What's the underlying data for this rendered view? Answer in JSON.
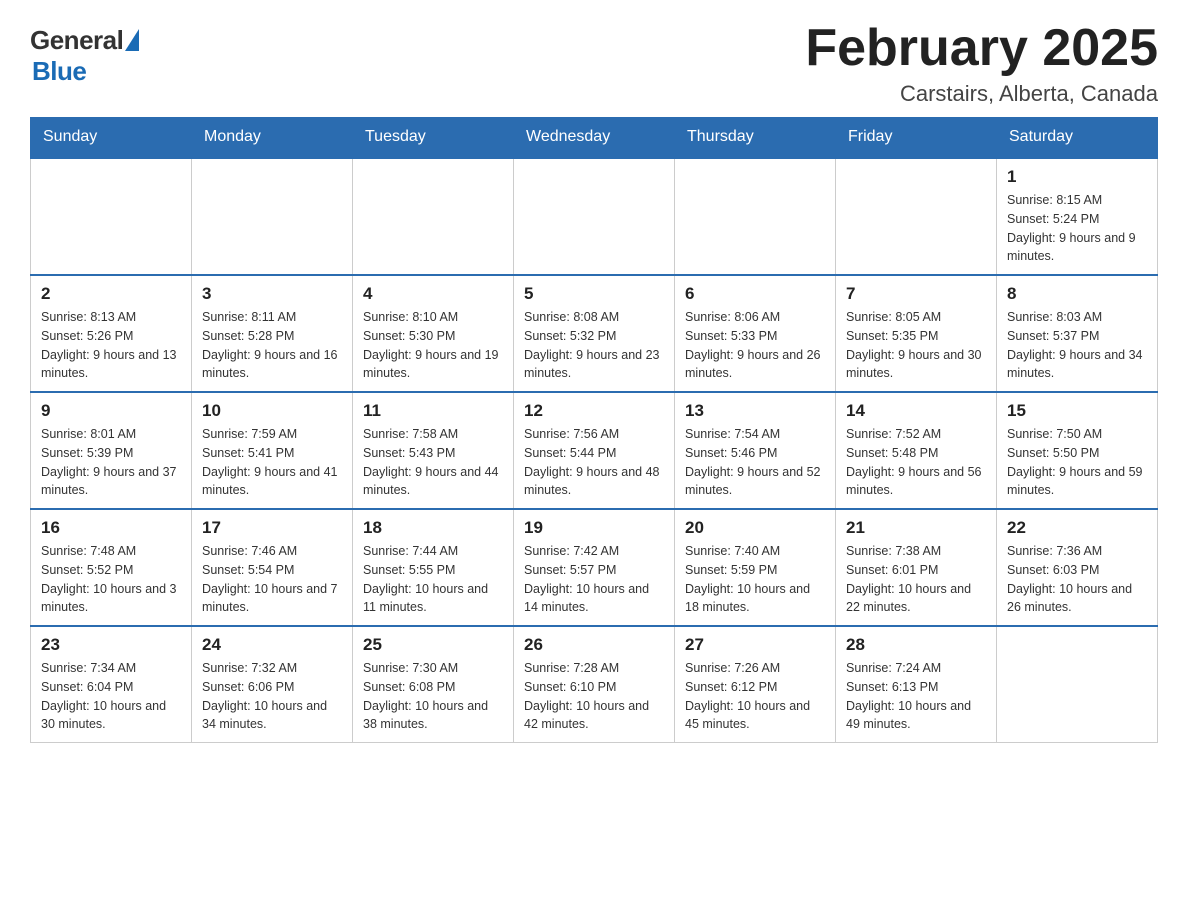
{
  "header": {
    "logo": {
      "general": "General",
      "blue": "Blue"
    },
    "title": "February 2025",
    "location": "Carstairs, Alberta, Canada"
  },
  "days_of_week": [
    "Sunday",
    "Monday",
    "Tuesday",
    "Wednesday",
    "Thursday",
    "Friday",
    "Saturday"
  ],
  "weeks": [
    [
      {
        "day": "",
        "info": ""
      },
      {
        "day": "",
        "info": ""
      },
      {
        "day": "",
        "info": ""
      },
      {
        "day": "",
        "info": ""
      },
      {
        "day": "",
        "info": ""
      },
      {
        "day": "",
        "info": ""
      },
      {
        "day": "1",
        "info": "Sunrise: 8:15 AM\nSunset: 5:24 PM\nDaylight: 9 hours and 9 minutes."
      }
    ],
    [
      {
        "day": "2",
        "info": "Sunrise: 8:13 AM\nSunset: 5:26 PM\nDaylight: 9 hours and 13 minutes."
      },
      {
        "day": "3",
        "info": "Sunrise: 8:11 AM\nSunset: 5:28 PM\nDaylight: 9 hours and 16 minutes."
      },
      {
        "day": "4",
        "info": "Sunrise: 8:10 AM\nSunset: 5:30 PM\nDaylight: 9 hours and 19 minutes."
      },
      {
        "day": "5",
        "info": "Sunrise: 8:08 AM\nSunset: 5:32 PM\nDaylight: 9 hours and 23 minutes."
      },
      {
        "day": "6",
        "info": "Sunrise: 8:06 AM\nSunset: 5:33 PM\nDaylight: 9 hours and 26 minutes."
      },
      {
        "day": "7",
        "info": "Sunrise: 8:05 AM\nSunset: 5:35 PM\nDaylight: 9 hours and 30 minutes."
      },
      {
        "day": "8",
        "info": "Sunrise: 8:03 AM\nSunset: 5:37 PM\nDaylight: 9 hours and 34 minutes."
      }
    ],
    [
      {
        "day": "9",
        "info": "Sunrise: 8:01 AM\nSunset: 5:39 PM\nDaylight: 9 hours and 37 minutes."
      },
      {
        "day": "10",
        "info": "Sunrise: 7:59 AM\nSunset: 5:41 PM\nDaylight: 9 hours and 41 minutes."
      },
      {
        "day": "11",
        "info": "Sunrise: 7:58 AM\nSunset: 5:43 PM\nDaylight: 9 hours and 44 minutes."
      },
      {
        "day": "12",
        "info": "Sunrise: 7:56 AM\nSunset: 5:44 PM\nDaylight: 9 hours and 48 minutes."
      },
      {
        "day": "13",
        "info": "Sunrise: 7:54 AM\nSunset: 5:46 PM\nDaylight: 9 hours and 52 minutes."
      },
      {
        "day": "14",
        "info": "Sunrise: 7:52 AM\nSunset: 5:48 PM\nDaylight: 9 hours and 56 minutes."
      },
      {
        "day": "15",
        "info": "Sunrise: 7:50 AM\nSunset: 5:50 PM\nDaylight: 9 hours and 59 minutes."
      }
    ],
    [
      {
        "day": "16",
        "info": "Sunrise: 7:48 AM\nSunset: 5:52 PM\nDaylight: 10 hours and 3 minutes."
      },
      {
        "day": "17",
        "info": "Sunrise: 7:46 AM\nSunset: 5:54 PM\nDaylight: 10 hours and 7 minutes."
      },
      {
        "day": "18",
        "info": "Sunrise: 7:44 AM\nSunset: 5:55 PM\nDaylight: 10 hours and 11 minutes."
      },
      {
        "day": "19",
        "info": "Sunrise: 7:42 AM\nSunset: 5:57 PM\nDaylight: 10 hours and 14 minutes."
      },
      {
        "day": "20",
        "info": "Sunrise: 7:40 AM\nSunset: 5:59 PM\nDaylight: 10 hours and 18 minutes."
      },
      {
        "day": "21",
        "info": "Sunrise: 7:38 AM\nSunset: 6:01 PM\nDaylight: 10 hours and 22 minutes."
      },
      {
        "day": "22",
        "info": "Sunrise: 7:36 AM\nSunset: 6:03 PM\nDaylight: 10 hours and 26 minutes."
      }
    ],
    [
      {
        "day": "23",
        "info": "Sunrise: 7:34 AM\nSunset: 6:04 PM\nDaylight: 10 hours and 30 minutes."
      },
      {
        "day": "24",
        "info": "Sunrise: 7:32 AM\nSunset: 6:06 PM\nDaylight: 10 hours and 34 minutes."
      },
      {
        "day": "25",
        "info": "Sunrise: 7:30 AM\nSunset: 6:08 PM\nDaylight: 10 hours and 38 minutes."
      },
      {
        "day": "26",
        "info": "Sunrise: 7:28 AM\nSunset: 6:10 PM\nDaylight: 10 hours and 42 minutes."
      },
      {
        "day": "27",
        "info": "Sunrise: 7:26 AM\nSunset: 6:12 PM\nDaylight: 10 hours and 45 minutes."
      },
      {
        "day": "28",
        "info": "Sunrise: 7:24 AM\nSunset: 6:13 PM\nDaylight: 10 hours and 49 minutes."
      },
      {
        "day": "",
        "info": ""
      }
    ]
  ]
}
